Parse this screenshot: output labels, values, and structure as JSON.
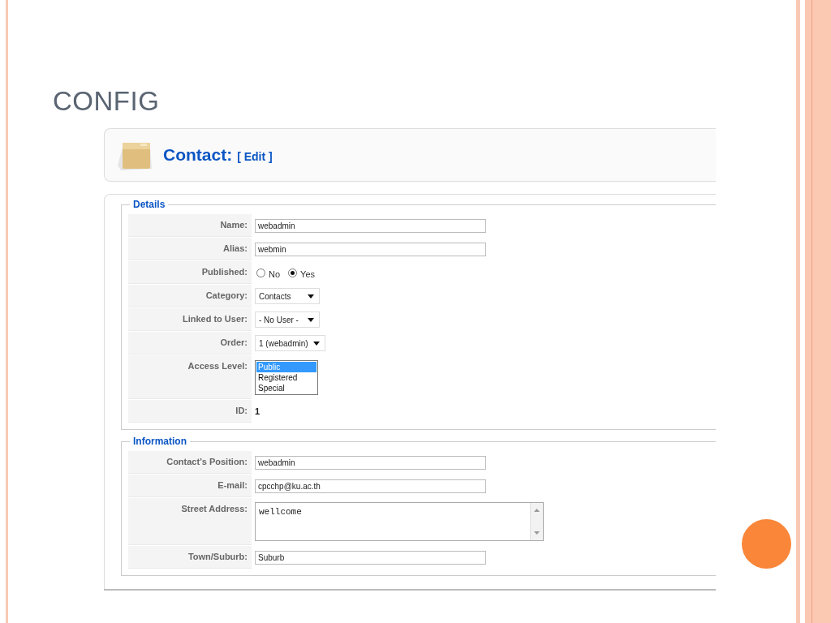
{
  "slide": {
    "title": "CONFIG"
  },
  "screenshot": {
    "header": {
      "title": "Contact:",
      "action": "[ Edit ]"
    },
    "fieldsets": [
      {
        "legend": "Details",
        "rows": [
          {
            "kind": "text",
            "label": "Name:",
            "value": "webadmin"
          },
          {
            "kind": "text",
            "label": "Alias:",
            "value": "webmin"
          },
          {
            "kind": "radio",
            "label": "Published:",
            "options": [
              {
                "label": "No",
                "selected": false
              },
              {
                "label": "Yes",
                "selected": true
              }
            ]
          },
          {
            "kind": "select",
            "label": "Category:",
            "value": "Contacts"
          },
          {
            "kind": "select",
            "label": "Linked to User:",
            "value": "- No User -"
          },
          {
            "kind": "select",
            "label": "Order:",
            "value": "1 (webadmin)"
          },
          {
            "kind": "listbox",
            "label": "Access Level:",
            "options": [
              {
                "label": "Public",
                "selected": true
              },
              {
                "label": "Registered",
                "selected": false
              },
              {
                "label": "Special",
                "selected": false
              }
            ]
          },
          {
            "kind": "static",
            "label": "ID:",
            "value": "1"
          }
        ]
      },
      {
        "legend": "Information",
        "rows": [
          {
            "kind": "text",
            "label": "Contact's Position:",
            "value": "webadmin"
          },
          {
            "kind": "text",
            "label": "E-mail:",
            "value": "cpcchp@ku.ac.th"
          },
          {
            "kind": "textarea",
            "label": "Street Address:",
            "value": "wellcome"
          },
          {
            "kind": "text",
            "label": "Town/Suburb:",
            "value": "Suburb"
          }
        ]
      }
    ]
  }
}
